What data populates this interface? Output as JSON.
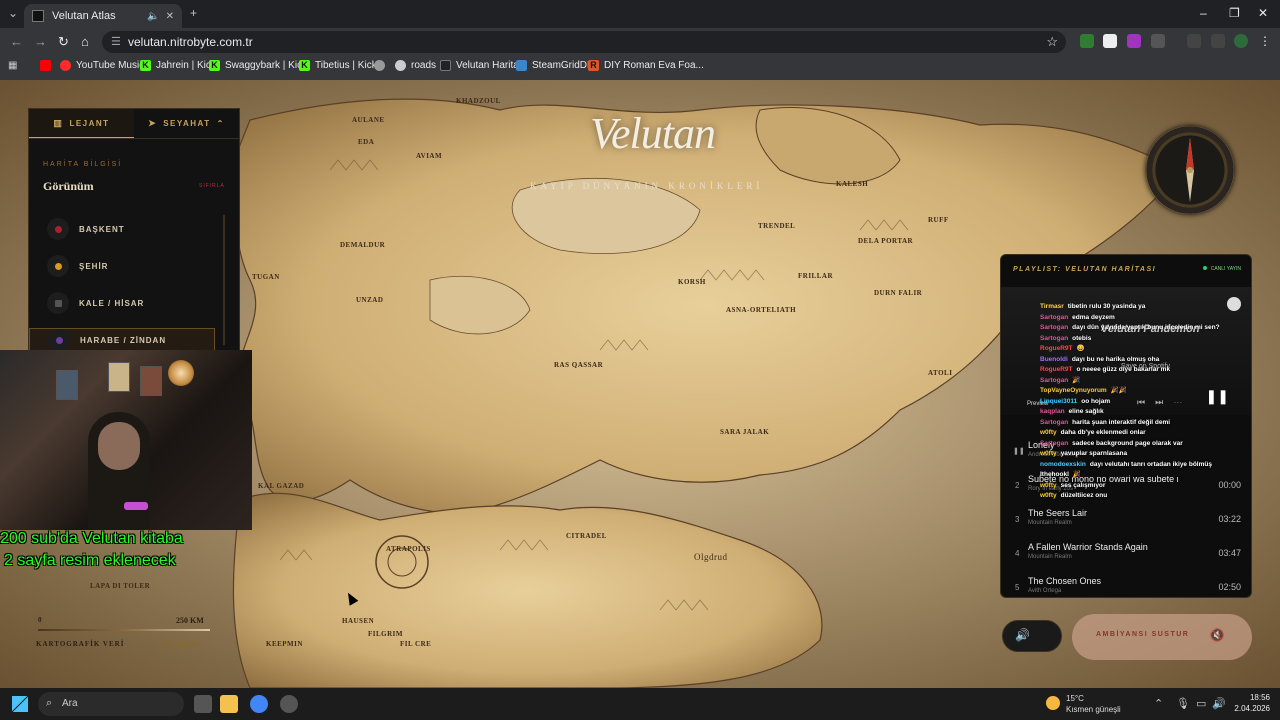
{
  "browser": {
    "tab_title": "Velutan Atlas",
    "url": "velutan.nitrobyte.com.tr",
    "bookmarks": [
      "YouTube Music",
      "Jahrein | Kick",
      "Swaggybark | Kick",
      "Tibetius | Kick",
      "roads",
      "Velutan Harita",
      "SteamGridDB",
      "DIY Roman Eva Foa..."
    ]
  },
  "map": {
    "logo": "Velutan",
    "subtitle": "KAYIP DÜNYANIN KRONİKLERİ",
    "labels": [
      "KHADZOUL",
      "AULANE",
      "EDA",
      "AVIAM",
      "DEMALDUR",
      "TUGAN",
      "UNZAD",
      "KORSH",
      "ASNA-ORTELIATH",
      "TRENDEL",
      "RUFF",
      "DELA PORTAR",
      "FRILLAR",
      "DURN FALIR",
      "KALESH",
      "RAS QASSAR",
      "ATOLI",
      "SARA JALAK",
      "KAL GAZAD",
      "ATRAPOLIS",
      "CITRADEL",
      "Olgdrud",
      "HAUSEN",
      "FILGRIM",
      "FIL CRE",
      "LAPA DI TOLER",
      "KEEPMIN"
    ]
  },
  "sidebar": {
    "tab_legend": "LEJANT",
    "tab_travel": "SEYAHAT",
    "section_kicker": "HARİTA BİLGİSİ",
    "section_title": "Görünüm",
    "reset": "SIFIRLA",
    "items": [
      {
        "label": "BAŞKENT",
        "color": "#b0202a"
      },
      {
        "label": "ŞEHİR",
        "color": "#d89a20"
      },
      {
        "label": "KALE / HİSAR",
        "color": "#555555"
      },
      {
        "label": "HARABE / ZİNDAN",
        "color": "#6a3fa0"
      }
    ]
  },
  "stream_overlay": {
    "line1": "200 sub'da Velutan kitaba",
    "line2": "2 sayfa resim eklenecek"
  },
  "scale": {
    "start": "0",
    "end": "250 KM",
    "label": "KARTOGRAFİK VERİ",
    "zoom": "1.02x Büyütme"
  },
  "player": {
    "header": "PLAYLIST: VELUTAN HARİTASI",
    "live": "CANLI YAYIN",
    "playlist_name": "Velutan Pandemon",
    "save": "Save on Spotify",
    "preview": "Preview",
    "tracks": [
      {
        "n": "",
        "title": "Lonely",
        "artist": "Andreas Rönnberg",
        "duration": ""
      },
      {
        "n": "2",
        "title": "Subete no mono no owari wa subete no hajimari",
        "artist": "Rory in early 20s",
        "duration": "00:00"
      },
      {
        "n": "3",
        "title": "The Seers Lair",
        "artist": "Mountain Realm",
        "duration": "03:22"
      },
      {
        "n": "4",
        "title": "A Fallen Warrior Stands Again",
        "artist": "Mountain Realm",
        "duration": "03:47"
      },
      {
        "n": "5",
        "title": "The Chosen Ones",
        "artist": "Avith Ortega",
        "duration": "02:50"
      }
    ]
  },
  "chat": [
    {
      "user": "Tirmasr",
      "color": "#ffd54a",
      "msg": "tibetin rulu 30 yasinda ya"
    },
    {
      "user": "Sartogan",
      "color": "#e0559a",
      "msg": "edma deyzem"
    },
    {
      "user": "Sartogan",
      "color": "#e0559a",
      "msg": "dayı dün yayında yaptık bunu inceledin mi sen?"
    },
    {
      "user": "Sartogan",
      "color": "#e0559a",
      "msg": "otebis"
    },
    {
      "user": "RogueR9T",
      "color": "#ff4545",
      "msg": "😄"
    },
    {
      "user": "Buenoldi",
      "color": "#a070ff",
      "msg": "dayı bu ne harika olmuş oha"
    },
    {
      "user": "RogueR9T",
      "color": "#ff4545",
      "msg": "o neeee güzz diye bakarlar mk"
    },
    {
      "user": "Sartogan",
      "color": "#e0559a",
      "msg": "🎉"
    },
    {
      "user": "TopVayneOynuyorum",
      "color": "#ffcc33",
      "msg": "🎉🎉"
    },
    {
      "user": "Linquei3011",
      "color": "#3fd0ff",
      "msg": "oo hojam"
    },
    {
      "user": "kaqplan",
      "color": "#e0559a",
      "msg": "eline sağlık"
    },
    {
      "user": "Sartogan",
      "color": "#e0559a",
      "msg": "harita şuan interaktif değil demi"
    },
    {
      "user": "w0fty",
      "color": "#ffcc33",
      "msg": "daha db'ye eklenmedi onlar"
    },
    {
      "user": "Sartogan",
      "color": "#e0559a",
      "msg": "sadece background page olarak var"
    },
    {
      "user": "w0fty",
      "color": "#ffcc33",
      "msg": "yavuplar sparnlasana"
    },
    {
      "user": "nomodoexskin",
      "color": "#3fd0ff",
      "msg": "dayı velutahı tanrı ortadan ikiye bölmüş"
    },
    {
      "user": "Ithehookl",
      "color": "#ffffff",
      "msg": "🎉"
    },
    {
      "user": "w0fty",
      "color": "#ffcc33",
      "msg": "ses çalışmıyor"
    },
    {
      "user": "w0fty",
      "color": "#ffcc33",
      "msg": "düzeltiicez onu"
    }
  ],
  "ambience": {
    "mute_label": "AMBİYANSI SUSTUR"
  },
  "taskbar": {
    "search": "Ara",
    "temp": "15°C",
    "weather": "Kısmen güneşli",
    "time": "18:56",
    "date": "2.04.2026"
  }
}
